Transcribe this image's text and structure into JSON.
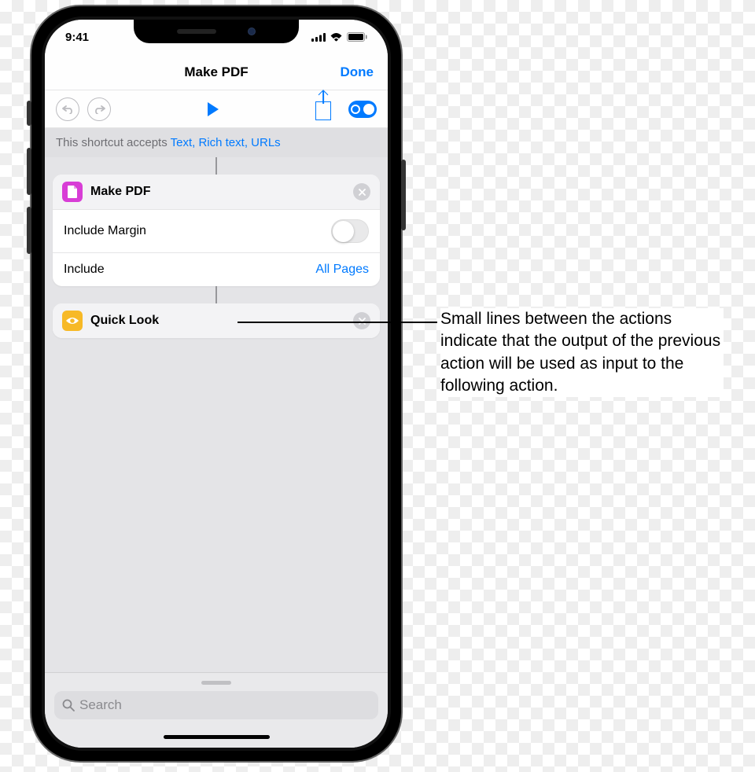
{
  "status": {
    "time": "9:41"
  },
  "nav": {
    "title": "Make PDF",
    "done": "Done"
  },
  "accepts": {
    "prefix": "This shortcut accepts ",
    "types": "Text, Rich text, URLs"
  },
  "action1": {
    "title": "Make PDF",
    "row1_label": "Include Margin",
    "row2_label": "Include",
    "row2_value": "All Pages"
  },
  "action2": {
    "title": "Quick Look"
  },
  "search": {
    "placeholder": "Search"
  },
  "callout": {
    "text": "Small lines between the actions indicate that the output of the previous action will be used as input to the following action."
  }
}
